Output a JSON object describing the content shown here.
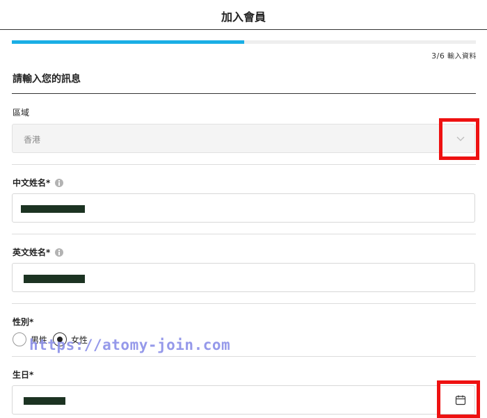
{
  "header": {
    "title": "加入會員"
  },
  "progress": {
    "fraction": 0.5,
    "current": "3",
    "separator": "/",
    "total": "6",
    "label": "輸入資料"
  },
  "section": {
    "title": "請輸入您的訊息"
  },
  "region": {
    "label": "區域",
    "value": "香港"
  },
  "chinese_name": {
    "label": "中文姓名*"
  },
  "english_name": {
    "label": "英文姓名*"
  },
  "gender": {
    "label": "性別*",
    "options": [
      "男性",
      "女性"
    ],
    "selected": "女性"
  },
  "birthday": {
    "label": "生日*"
  },
  "watermark": {
    "text": "https://atomy-join.com"
  },
  "colors": {
    "progress": "#1aaee5",
    "highlight": "#ee1111",
    "redaction": "#1c3322"
  },
  "icons": {
    "dropdown": "chevron-down-icon",
    "calendar": "calendar-icon",
    "info": "info-icon"
  }
}
